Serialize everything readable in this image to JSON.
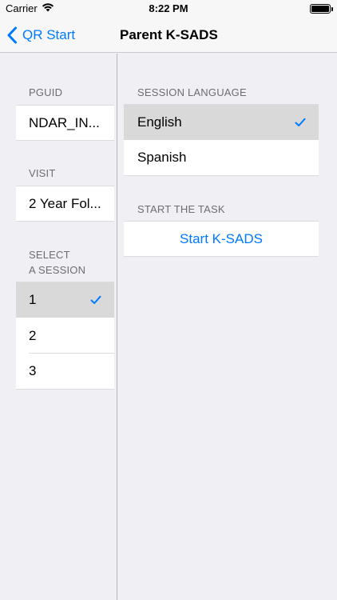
{
  "status_bar": {
    "carrier": "Carrier",
    "time": "8:22 PM",
    "icons": [
      "wifi-icon",
      "battery-icon"
    ]
  },
  "nav": {
    "back_label": "QR Start",
    "title": "Parent K-SADS",
    "accent_color": "#007aff"
  },
  "master": {
    "pguid_header": "PGUID",
    "pguid_value": "NDAR_IN...",
    "visit_header": "VISIT",
    "visit_value": "2 Year Fol...",
    "session_header_line1": "SELECT",
    "session_header_line2": "A SESSION",
    "sessions": [
      {
        "label": "1",
        "selected": true
      },
      {
        "label": "2",
        "selected": false
      },
      {
        "label": "3",
        "selected": false
      }
    ]
  },
  "detail": {
    "language_header": "SESSION LANGUAGE",
    "languages": [
      {
        "label": "English",
        "selected": true
      },
      {
        "label": "Spanish",
        "selected": false
      }
    ],
    "task_header": "START THE TASK",
    "start_button": "Start K-SADS"
  }
}
